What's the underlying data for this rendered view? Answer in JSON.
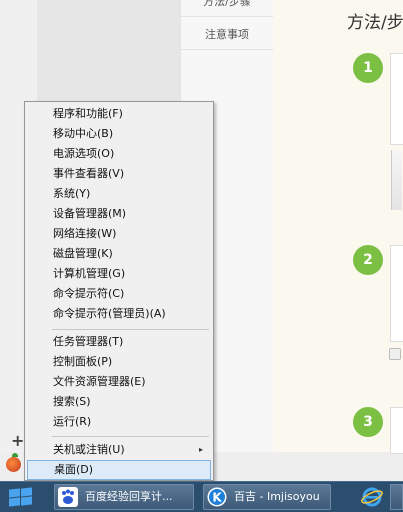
{
  "article": {
    "nav_tabs": [
      "方法/步骤",
      "注意事项"
    ],
    "heading": "方法/步",
    "steps": [
      "1",
      "2",
      "3"
    ]
  },
  "desktop": {
    "plus_label": "+"
  },
  "context_menu": {
    "group1": [
      "程序和功能(F)",
      "移动中心(B)",
      "电源选项(O)",
      "事件查看器(V)",
      "系统(Y)",
      "设备管理器(M)",
      "网络连接(W)",
      "磁盘管理(K)",
      "计算机管理(G)",
      "命令提示符(C)",
      "命令提示符(管理员)(A)"
    ],
    "group2": [
      "任务管理器(T)",
      "控制面板(P)",
      "文件资源管理器(E)",
      "搜索(S)",
      "运行(R)"
    ],
    "group3": [
      "关机或注销(U)",
      "桌面(D)"
    ],
    "submenu_arrow": "▸",
    "highlighted_item": "桌面(D)"
  },
  "taskbar": {
    "task1_label": "百度经验回享计...",
    "task2_label": "百吉 - Imjisoyou",
    "task2_icon_letter": "K",
    "colors": {
      "taskbar_bg": "#2b4e6e",
      "start_logo": "#4aa3ee",
      "step_badge": "#7bc043"
    }
  }
}
